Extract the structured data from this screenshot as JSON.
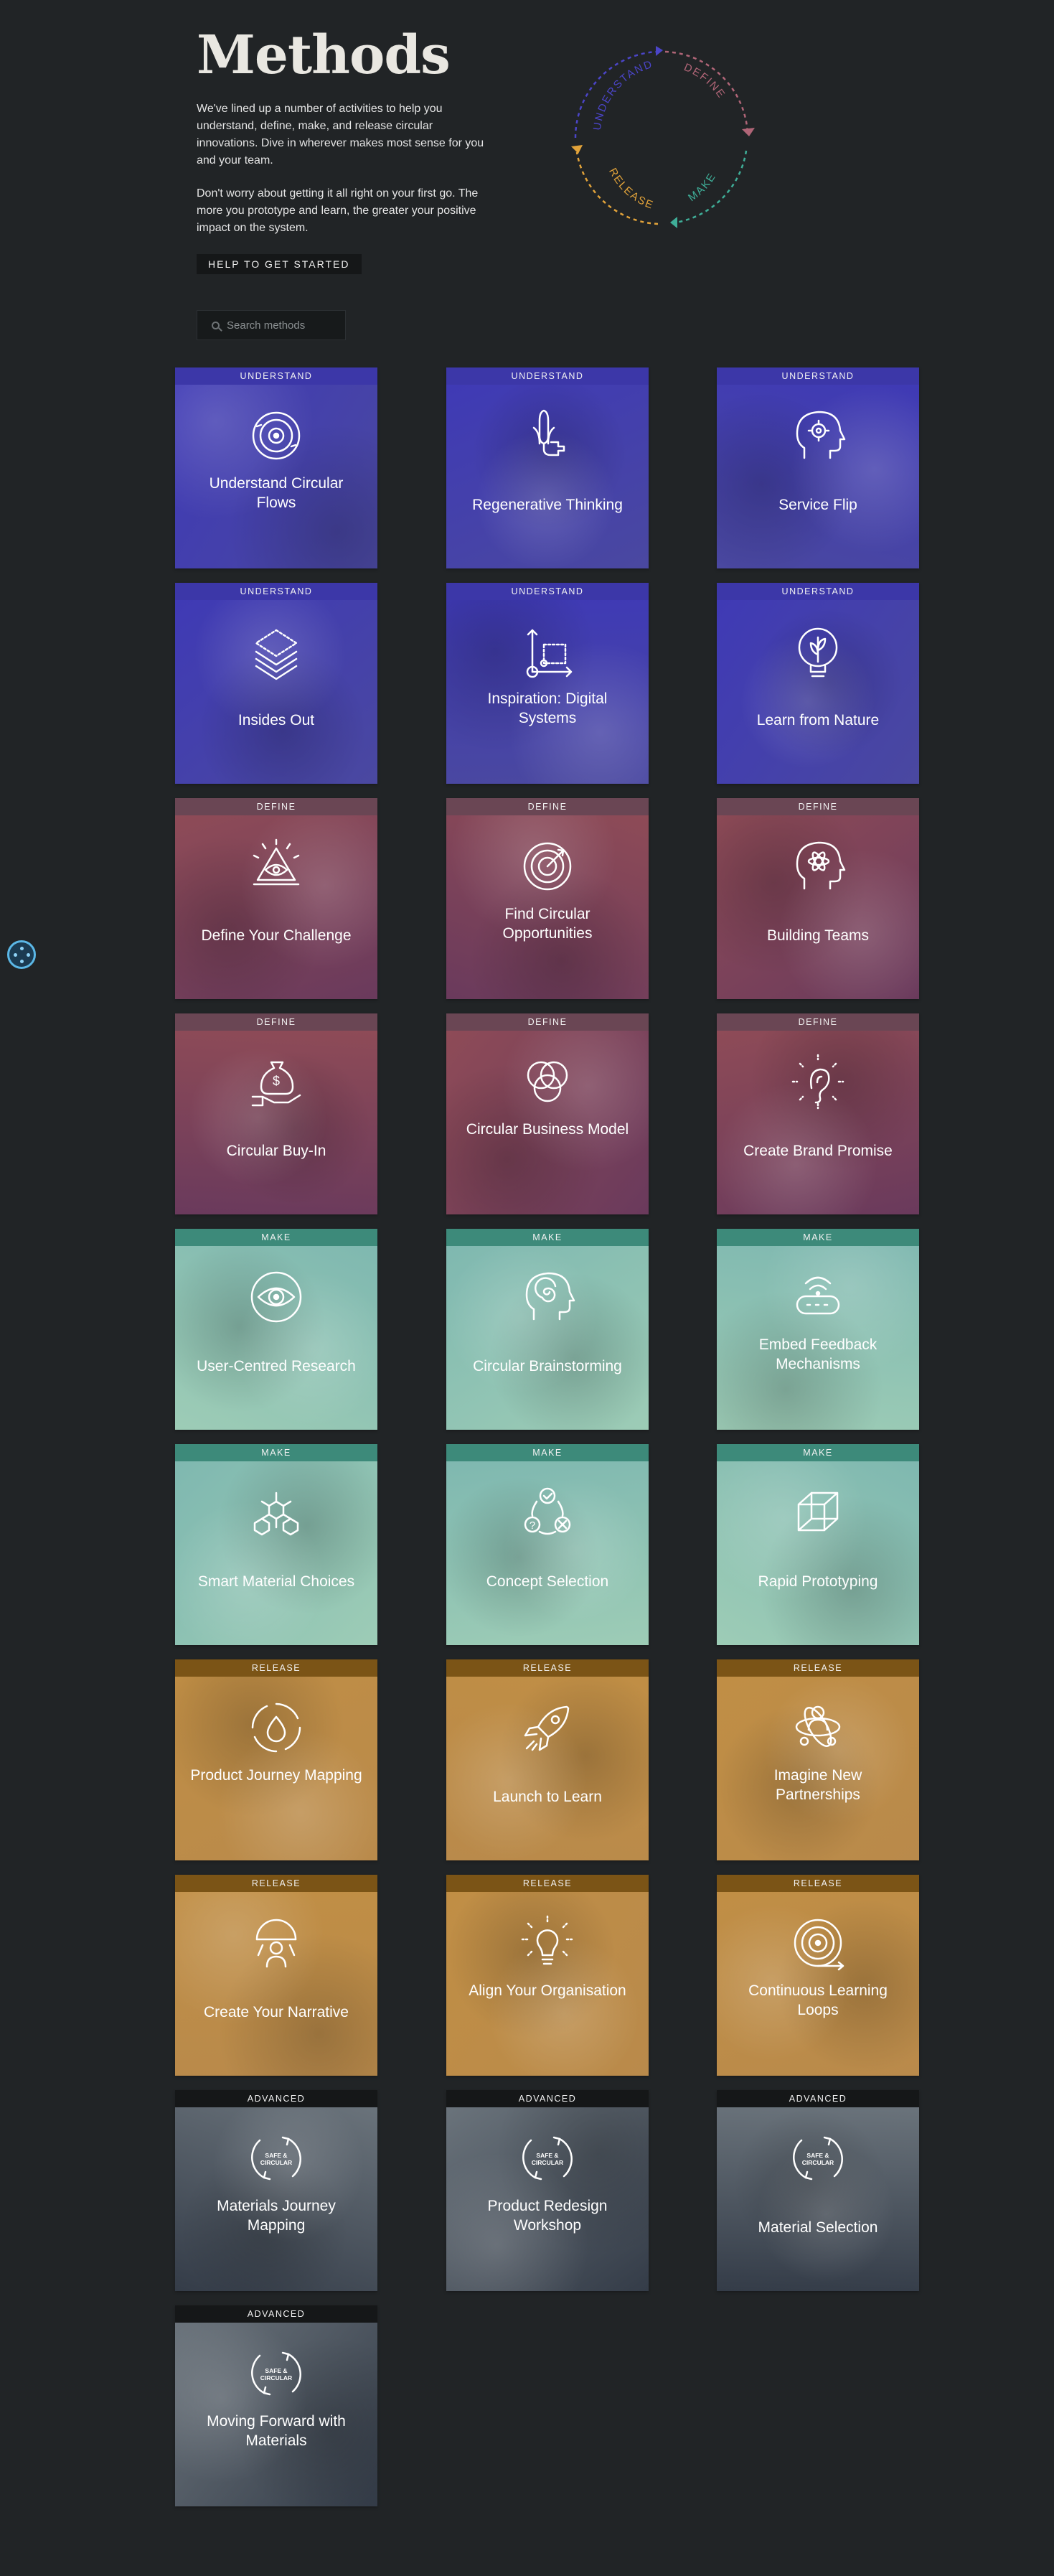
{
  "header": {
    "title": "Methods",
    "intro_p1": "We've lined up a number of activities to help you understand, define, make, and release circular innovations. Dive in wherever makes most sense for you and your team.",
    "intro_p2": "Don't worry about getting it all right on your first go. The more you prototype and learn, the greater your positive impact on the system.",
    "help_button": "HELP TO GET STARTED"
  },
  "cycle": {
    "phases": [
      "UNDERSTAND",
      "DEFINE",
      "MAKE",
      "RELEASE"
    ],
    "colors": {
      "understand": "#4b45c8",
      "define": "#b06577",
      "make": "#3fae98",
      "release": "#e2a33a"
    }
  },
  "search": {
    "placeholder": "Search methods"
  },
  "card_styles": {
    "UNDERSTAND": {
      "header": "#3c37a8",
      "bg1": "#3f3ab5",
      "bg2": "#4a48a0"
    },
    "DEFINE": {
      "header": "#6a4654",
      "bg1": "#8e4b57",
      "bg2": "#6a3a5c"
    },
    "MAKE": {
      "header": "#3d8a7a",
      "bg1": "#7fb8b0",
      "bg2": "#9dccb6"
    },
    "RELEASE": {
      "header": "#7b5416",
      "bg1": "#c08e45",
      "bg2": "#b98a4b"
    },
    "ADVANCED": {
      "header": "#151718",
      "bg1": "#6a737b",
      "bg2": "#343c48"
    }
  },
  "methods": [
    {
      "category": "UNDERSTAND",
      "name": "Understand Circular Flows",
      "icon": "circular-flows-icon"
    },
    {
      "category": "UNDERSTAND",
      "name": "Regenerative Thinking",
      "icon": "corn-plug-icon"
    },
    {
      "category": "UNDERSTAND",
      "name": "Service Flip",
      "icon": "head-gear-icon"
    },
    {
      "category": "UNDERSTAND",
      "name": "Insides Out",
      "icon": "layers-icon"
    },
    {
      "category": "UNDERSTAND",
      "name": "Inspiration: Digital Systems",
      "icon": "digital-systems-icon"
    },
    {
      "category": "UNDERSTAND",
      "name": "Learn from Nature",
      "icon": "leaf-bulb-icon"
    },
    {
      "category": "DEFINE",
      "name": "Define Your Challenge",
      "icon": "eye-pyramid-icon"
    },
    {
      "category": "DEFINE",
      "name": "Find Circular Opportunities",
      "icon": "target-icon"
    },
    {
      "category": "DEFINE",
      "name": "Building Teams",
      "icon": "head-atom-icon"
    },
    {
      "category": "DEFINE",
      "name": "Circular Buy-In",
      "icon": "money-bag-hand-icon"
    },
    {
      "category": "DEFINE",
      "name": "Circular Business Model",
      "icon": "venn-diagram-icon"
    },
    {
      "category": "DEFINE",
      "name": "Create Brand Promise",
      "icon": "ear-icon"
    },
    {
      "category": "MAKE",
      "name": "User-Centred Research",
      "icon": "eye-target-icon"
    },
    {
      "category": "MAKE",
      "name": "Circular Brainstorming",
      "icon": "head-spiral-icon"
    },
    {
      "category": "MAKE",
      "name": "Embed Feedback Mechanisms",
      "icon": "wireless-device-icon"
    },
    {
      "category": "MAKE",
      "name": "Smart Material Choices",
      "icon": "molecule-icon"
    },
    {
      "category": "MAKE",
      "name": "Concept Selection",
      "icon": "check-cycle-icon"
    },
    {
      "category": "MAKE",
      "name": "Rapid Prototyping",
      "icon": "cube-icon"
    },
    {
      "category": "RELEASE",
      "name": "Product Journey Mapping",
      "icon": "drop-cycle-icon"
    },
    {
      "category": "RELEASE",
      "name": "Launch to Learn",
      "icon": "rocket-icon"
    },
    {
      "category": "RELEASE",
      "name": "Imagine New Partnerships",
      "icon": "people-atom-icon"
    },
    {
      "category": "RELEASE",
      "name": "Create Your Narrative",
      "icon": "storyteller-icon"
    },
    {
      "category": "RELEASE",
      "name": "Align Your Organisation",
      "icon": "light-bulb-icon"
    },
    {
      "category": "RELEASE",
      "name": "Continuous Learning Loops",
      "icon": "spiral-loop-icon"
    },
    {
      "category": "ADVANCED",
      "name": "Materials Journey Mapping",
      "icon": "safe-circular-icon",
      "badge": "SAFE & CIRCULAR"
    },
    {
      "category": "ADVANCED",
      "name": "Product Redesign Workshop",
      "icon": "safe-circular-icon",
      "badge": "SAFE & CIRCULAR"
    },
    {
      "category": "ADVANCED",
      "name": "Material Selection",
      "icon": "safe-circular-icon",
      "badge": "SAFE & CIRCULAR"
    },
    {
      "category": "ADVANCED",
      "name": "Moving Forward with Materials",
      "icon": "safe-circular-icon",
      "badge": "SAFE & CIRCULAR"
    }
  ]
}
